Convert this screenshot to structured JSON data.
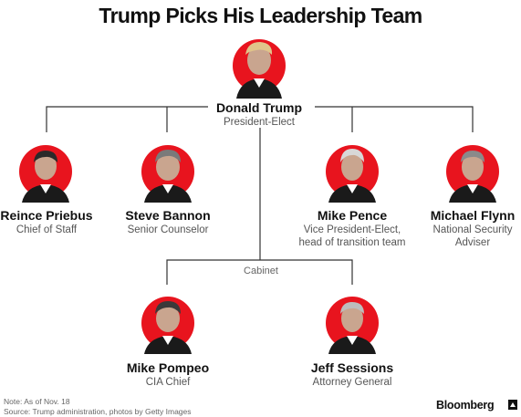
{
  "title": "Trump Picks His Leadership Team",
  "people": {
    "trump": {
      "name": "Donald Trump",
      "role_lines": [
        "President-Elect"
      ]
    },
    "priebus": {
      "name": "Reince Priebus",
      "role_lines": [
        "Chief of Staff"
      ]
    },
    "bannon": {
      "name": "Steve Bannon",
      "role_lines": [
        "Senior Counselor"
      ]
    },
    "pence": {
      "name": "Mike Pence",
      "role_lines": [
        "Vice President-Elect,",
        "head of transition team"
      ]
    },
    "flynn": {
      "name": "Michael Flynn",
      "role_lines": [
        "National Security",
        "Adviser"
      ]
    },
    "pompeo": {
      "name": "Mike Pompeo",
      "role_lines": [
        "CIA Chief"
      ]
    },
    "sessions": {
      "name": "Jeff Sessions",
      "role_lines": [
        "Attorney General"
      ]
    }
  },
  "cabinet_label": "Cabinet",
  "footer": {
    "note": "Note: As of Nov. 18",
    "source": "Source: Trump administration, photos by Getty Images",
    "brand": "Bloomberg"
  },
  "colors": {
    "accent": "#e8141e",
    "line": "#333333",
    "shirt": "#ffffff",
    "suit": "#1a1a1a",
    "skin": "#c9a58f",
    "hair_gray": "#cfcfcf",
    "hair_dark": "#2a2a2a"
  }
}
